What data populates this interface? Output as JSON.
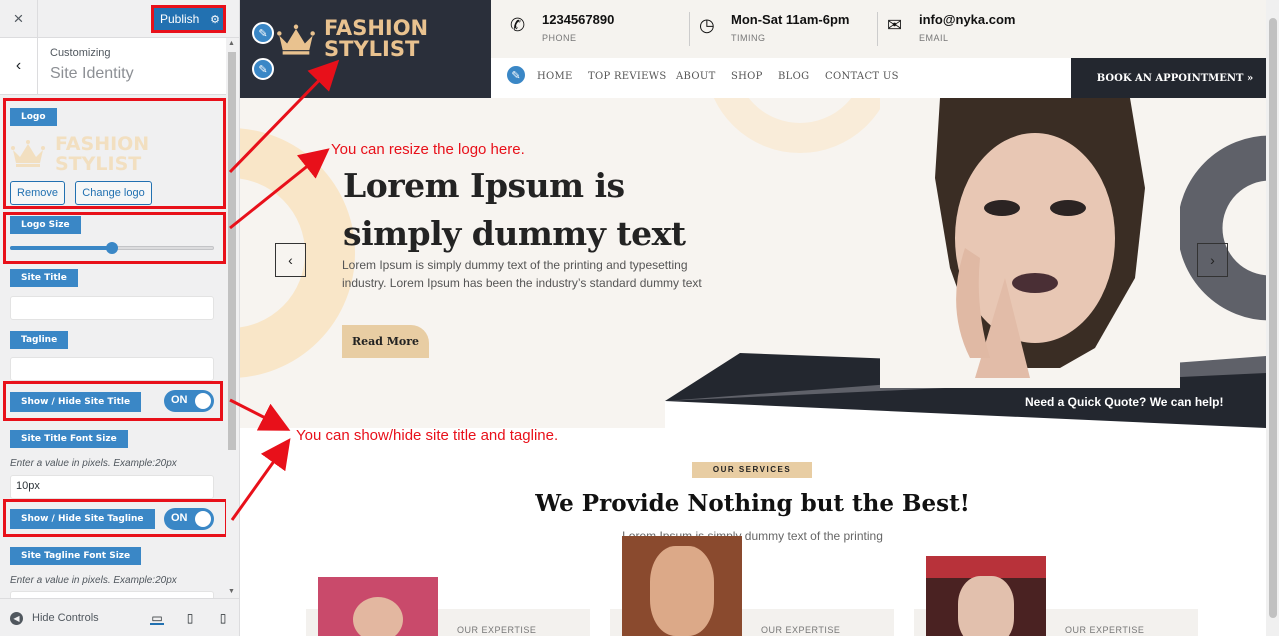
{
  "sidebar": {
    "close_icon": "×",
    "publish_label": "Publish",
    "customizing_label": "Customizing",
    "section_title": "Site Identity",
    "logo_label": "Logo",
    "logo_preview_line1": "FASHION",
    "logo_preview_line2": "STYLIST",
    "remove_label": "Remove",
    "change_logo_label": "Change logo",
    "logo_size_label": "Logo Size",
    "logo_size_value": 0.5,
    "site_title_label": "Site Title",
    "site_title_value": "",
    "tagline_label": "Tagline",
    "tagline_value": "",
    "show_title_label": "Show / Hide Site Title",
    "show_title_toggle": "ON",
    "title_font_size_label": "Site Title Font Size",
    "title_font_hint": "Enter a value in pixels. Example:20px",
    "title_font_value": "10px",
    "show_tagline_label": "Show / Hide Site Tagline",
    "show_tagline_toggle": "ON",
    "tagline_font_size_label": "Site Tagline Font Size",
    "tagline_font_hint": "Enter a value in pixels. Example:20px",
    "hide_controls_label": "Hide Controls"
  },
  "preview": {
    "logo_line1": "FASHION",
    "logo_line2": "STYLIST",
    "phone_value": "1234567890",
    "phone_label": "PHONE",
    "timing_value": "Mon-Sat 11am-6pm",
    "timing_label": "TIMING",
    "email_value": "info@nyka.com",
    "email_label": "EMAIL",
    "nav": [
      "HOME",
      "TOP REVIEWS",
      "ABOUT",
      "SHOP",
      "BLOG",
      "CONTACT US"
    ],
    "book_label": "BOOK AN APPOINTMENT",
    "hero_title_line1": "Lorem Ipsum is",
    "hero_title_line2": "simply dummy text",
    "hero_text": "Lorem Ipsum is simply dummy text of the printing and typesetting industry. Lorem Ipsum has been the industry’s standard dummy text",
    "read_more": "Read More",
    "quote_text": "Need a Quick Quote? We can help!",
    "services_tag": "OUR SERVICES",
    "services_heading": "We Provide Nothing but the Best!",
    "services_sub": "Lorem Ipsum is simply dummy text of the printing",
    "card_label": "OUR EXPERTISE"
  },
  "annotations": {
    "logo_note": "You can resize the logo here.",
    "title_note": "You can show/hide site title and tagline."
  },
  "colors": {
    "accent": "#3a87c6",
    "highlight": "#e8101a",
    "brand_gold": "#e9c28f",
    "dark": "#2a2f3a"
  }
}
